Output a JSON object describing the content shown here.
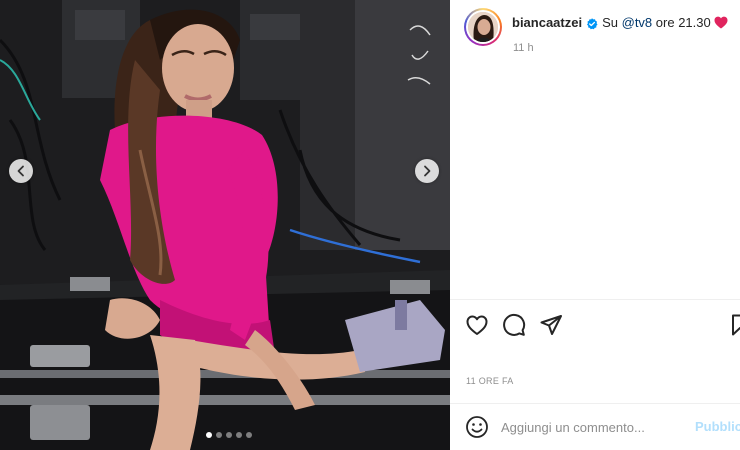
{
  "post": {
    "username": "biancaatzei",
    "caption": "Su",
    "mention": "@tv8",
    "caption_after": "ore 21.30",
    "time_ago": "11 h",
    "date": "11 ORE FA"
  },
  "comment": {
    "placeholder": "Aggiungi un commento...",
    "publish_label": "Pubblica"
  },
  "carousel": {
    "slide_count": 5,
    "active_index": 0
  },
  "colors": {
    "verified": "#0095f6",
    "heart": "#e0245e",
    "mention": "#00376b",
    "publish": "#b2dffc",
    "dress": "#e0188a"
  },
  "icons": {
    "like": "heart-outline-icon",
    "comment": "speech-bubble-icon",
    "share": "paper-plane-icon",
    "save": "bookmark-icon",
    "emoji": "smiley-icon",
    "prev": "chevron-left-icon",
    "next": "chevron-right-icon"
  }
}
